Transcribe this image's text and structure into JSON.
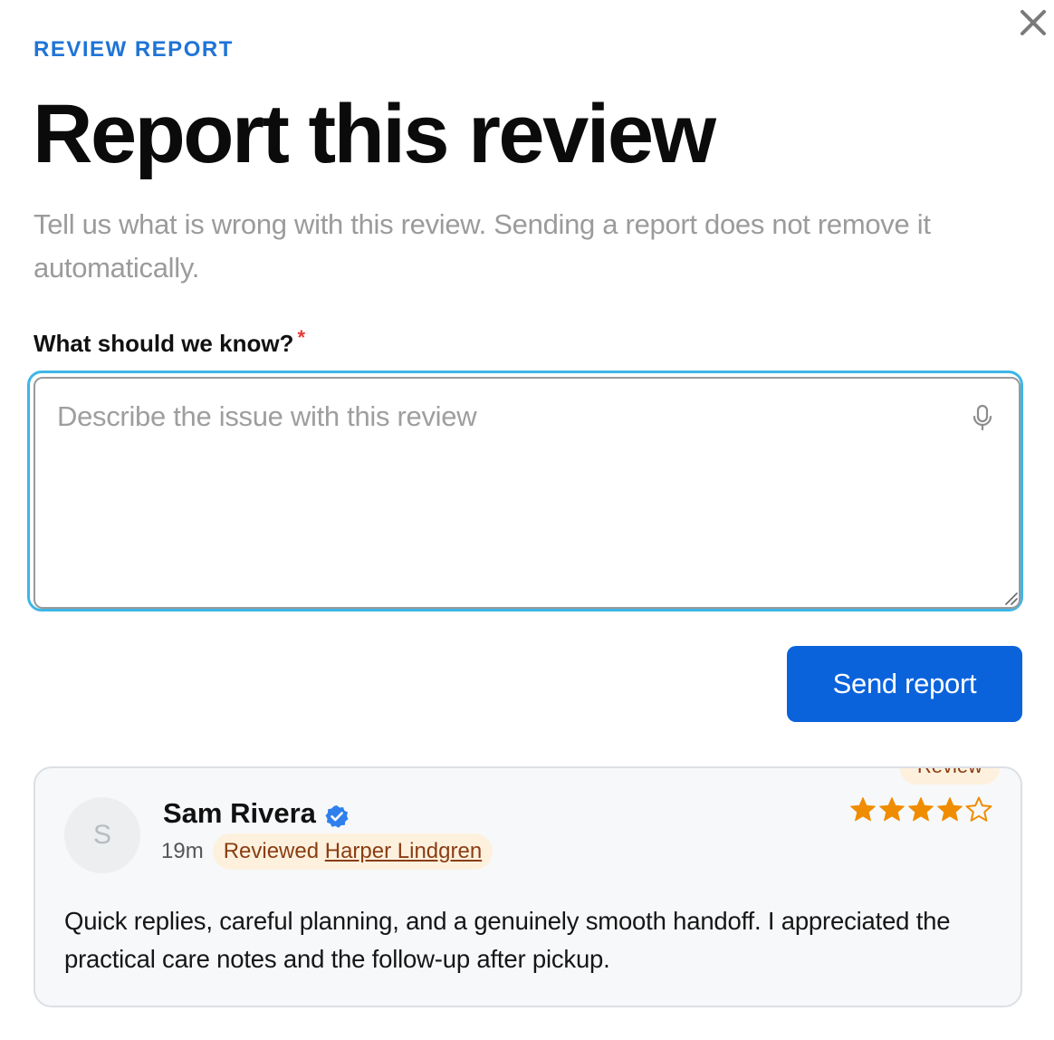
{
  "dialog": {
    "eyebrow": "REVIEW REPORT",
    "title": "Report this review",
    "subtitle": "Tell us what is wrong with this review. Sending a report does not remove it automatically.",
    "close_icon": "close-icon"
  },
  "form": {
    "label": "What should we know?",
    "required_mark": "*",
    "textarea_value": "",
    "textarea_placeholder": "Describe the issue with this review",
    "mic_icon": "microphone-icon",
    "submit_label": "Send report"
  },
  "review": {
    "badge": "Review",
    "avatar_initial": "S",
    "reviewer_name": "Sam Rivera",
    "verified": true,
    "time_ago": "19m",
    "reviewed_prefix": "Reviewed",
    "reviewed_name": "Harper Lindgren",
    "rating": 4,
    "rating_max": 5,
    "text": "Quick replies, careful planning, and a genuinely smooth handoff. I appreciated the practical care notes and the follow-up after pickup."
  },
  "colors": {
    "accent": "#1f74d6",
    "button": "#0b63dc",
    "focus_ring": "#3fb6e6",
    "star": "#f08c00",
    "required": "#e53935",
    "pill_bg": "#fdf1de",
    "pill_text": "#8a3d12"
  }
}
